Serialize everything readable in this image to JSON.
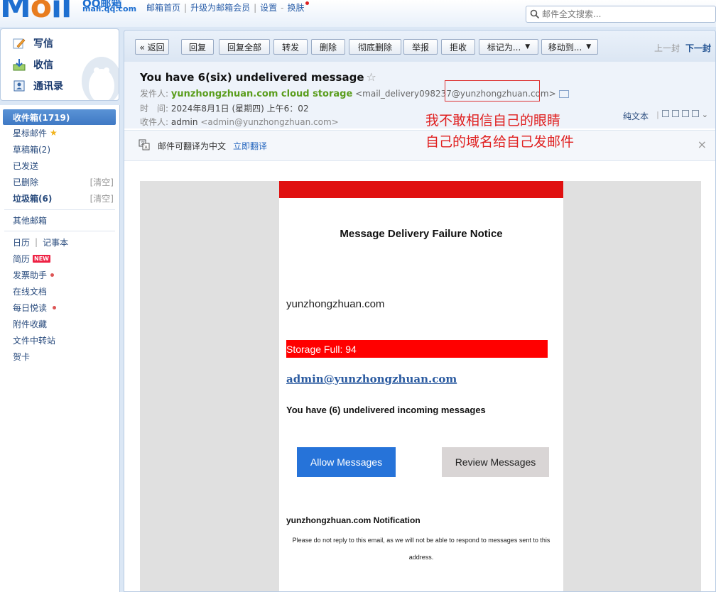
{
  "app": {
    "logo_text": "Mail",
    "logo_cn": "QQ邮箱",
    "logo_url": "mail.qq.com"
  },
  "topnav": {
    "items": [
      "邮箱首页",
      "升级为邮箱会员",
      "设置",
      "换肤"
    ]
  },
  "search": {
    "placeholder": "邮件全文搜索..."
  },
  "left_top": {
    "compose": "写信",
    "receive": "收信",
    "contacts": "通讯录"
  },
  "left_nav": {
    "inbox": "收件箱(1719)",
    "starred": "星标邮件",
    "drafts": "草稿箱(2)",
    "sent": "已发送",
    "deleted": "已删除",
    "spam": "垃圾箱(6)",
    "clear": "[清空]",
    "other_mailboxes": "其他邮箱",
    "calendar": "日历",
    "notes": "记事本",
    "resume": "简历",
    "new_badge": "NEW",
    "invoice": "发票助手",
    "online_docs": "在线文档",
    "daily_reading": "每日悦读",
    "attachments": "附件收藏",
    "file_transfer": "文件中转站",
    "cards": "贺卡"
  },
  "toolbar": {
    "back": "« 返回",
    "reply": "回复",
    "reply_all": "回复全部",
    "forward": "转发",
    "delete": "删除",
    "delete_permanently": "彻底删除",
    "report": "举报",
    "reject": "拒收",
    "mark_as": "标记为...",
    "move_to": "移动到...",
    "prev_mail": "上一封",
    "next_mail": "下一封"
  },
  "email_header": {
    "subject": "You have 6(six) undelivered message",
    "from_label": "发件人:",
    "sender_name": "yunzhongzhuan.com cloud storage",
    "sender_address": "<mail_delivery098237@yunzhongzhuan.com>",
    "time_label": "时　间:",
    "time_value": "2024年8月1日 (星期四) 上午6：02",
    "to_label": "收件人:",
    "to_name": "admin",
    "to_address": "<admin@yunzhongzhuan.com>",
    "plain_text": "纯文本",
    "annotation_line1": "我不敢相信自己的眼睛",
    "annotation_line2": "自己的域名给自己发邮件"
  },
  "translate_bar": {
    "text": "邮件可翻译为中文",
    "link": "立即翻译"
  },
  "email_body": {
    "title": "Message Delivery Failure Notice",
    "domain": "yunzhongzhuan.com",
    "storage_label": "Storage Full: 94",
    "admin_email": "admin@yunzhongzhuan.com",
    "undelivered_text": "You have (6) undelivered incoming messages",
    "allow_button": "Allow Messages",
    "review_button": "Review Messages",
    "notification_title": "yunzhongzhuan.com Notification",
    "notification_text": "Please do not reply to this email, as we will not be able to respond to messages sent to this address."
  },
  "colors": {
    "brand_blue": "#1e6fd0",
    "sender_green": "#5a9d1c",
    "alert_red": "#e01010",
    "allow_blue": "#2673d9"
  }
}
